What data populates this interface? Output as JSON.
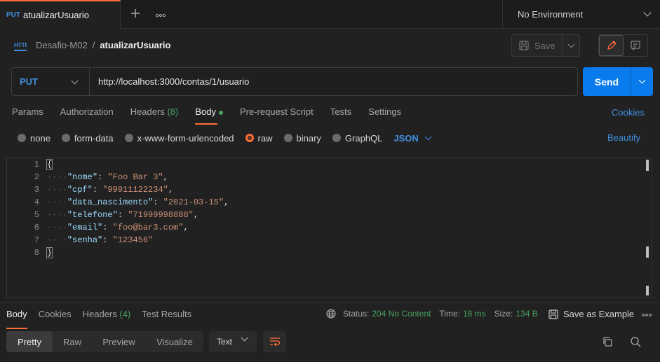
{
  "tab": {
    "method": "PUT",
    "name": "atualizarUsuario"
  },
  "environment": {
    "label": "No Environment"
  },
  "breadcrumb": {
    "collection": "Desafio-M02",
    "separator": "/",
    "request": "atualizarUsuario"
  },
  "header": {
    "save_label": "Save"
  },
  "request": {
    "method": "PUT",
    "url": "http://localhost:3000/contas/1/usuario",
    "send_label": "Send"
  },
  "req_tabs": {
    "params": "Params",
    "authorization": "Authorization",
    "headers": "Headers",
    "headers_count": "(8)",
    "body": "Body",
    "pre_request": "Pre-request Script",
    "tests": "Tests",
    "settings": "Settings",
    "cookies": "Cookies"
  },
  "body_types": {
    "none": "none",
    "form_data": "form-data",
    "urlencoded": "x-www-form-urlencoded",
    "raw": "raw",
    "binary": "binary",
    "graphql": "GraphQL",
    "format": "JSON",
    "beautify": "Beautify",
    "selected": "raw"
  },
  "editor": {
    "line_numbers": [
      "1",
      "2",
      "3",
      "4",
      "5",
      "6",
      "7",
      "8"
    ],
    "lines": [
      {
        "indent": "",
        "key": "",
        "value": "",
        "text": "{"
      },
      {
        "indent": "····",
        "key": "\"nome\"",
        "value": "\"Foo Bar 3\"",
        "text": ","
      },
      {
        "indent": "····",
        "key": "\"cpf\"",
        "value": "\"99911122234\"",
        "text": ","
      },
      {
        "indent": "····",
        "key": "\"data_nascimento\"",
        "value": "\"2021-03-15\"",
        "text": ","
      },
      {
        "indent": "····",
        "key": "\"telefone\"",
        "value": "\"71999998888\"",
        "text": ","
      },
      {
        "indent": "····",
        "key": "\"email\"",
        "value": "\"foo@bar3.com\"",
        "text": ","
      },
      {
        "indent": "····",
        "key": "\"senha\"",
        "value": "\"123456\"",
        "text": ""
      },
      {
        "indent": "",
        "key": "",
        "value": "",
        "text": "}"
      }
    ]
  },
  "response": {
    "tabs": {
      "body": "Body",
      "cookies": "Cookies",
      "headers": "Headers",
      "headers_count": "(4)",
      "test_results": "Test Results"
    },
    "status_label": "Status:",
    "status_value": "204 No Content",
    "time_label": "Time:",
    "time_value": "18 ms",
    "size_label": "Size:",
    "size_value": "134 B",
    "save_example": "Save as Example",
    "views": [
      "Pretty",
      "Raw",
      "Preview",
      "Visualize"
    ],
    "active_view": "Pretty",
    "format": "Text"
  },
  "colors": {
    "accent_orange": "#ff6c37",
    "link_blue": "#3f8fdf",
    "send_blue": "#097bed",
    "success_green": "#46a35e"
  }
}
